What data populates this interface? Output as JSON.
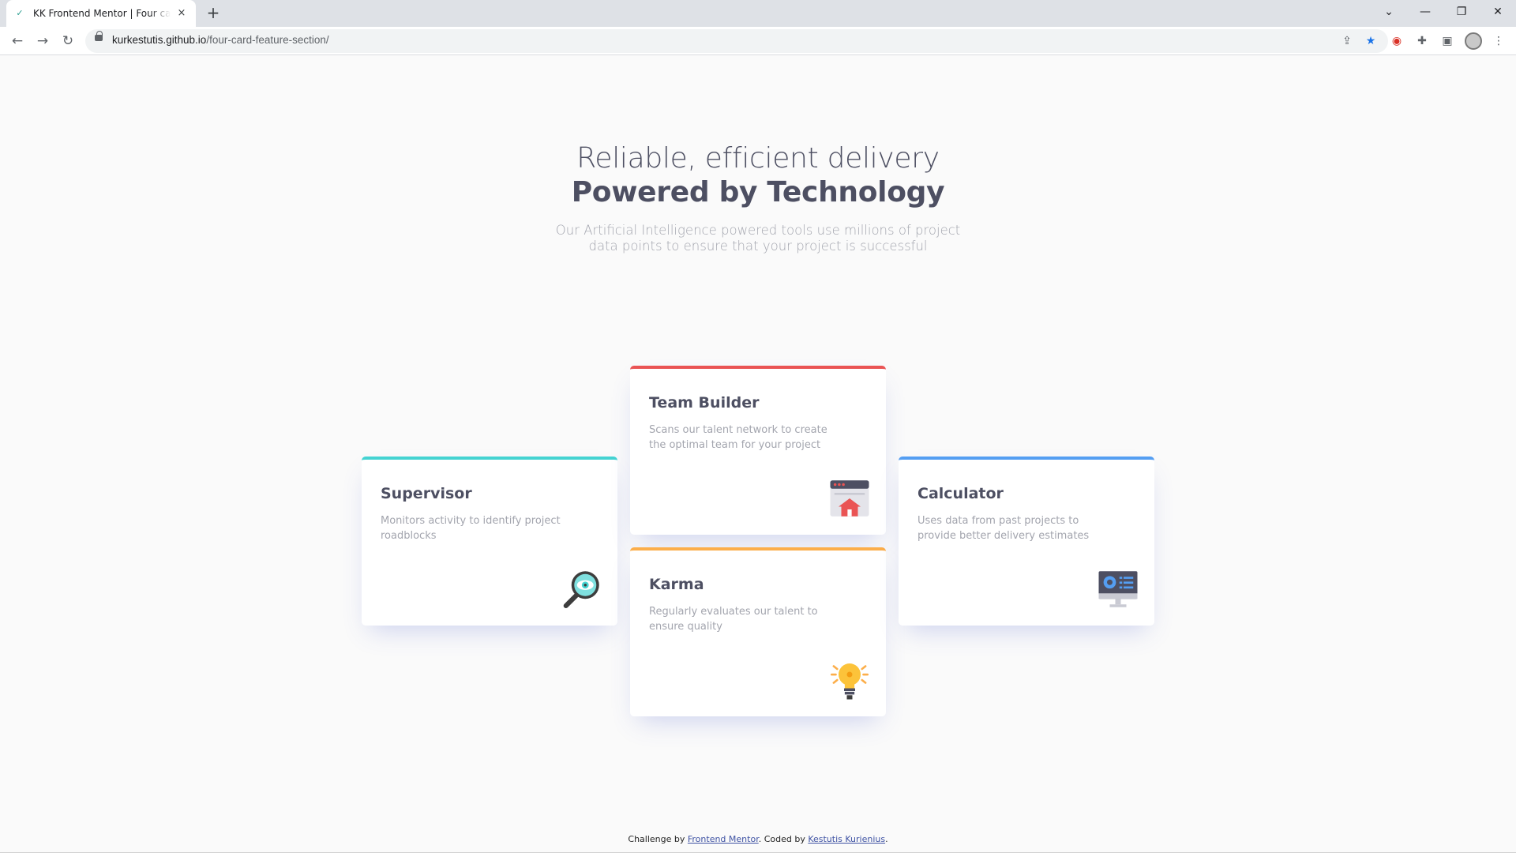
{
  "browser": {
    "tab_title": "KK Frontend Mentor | Four card feature section",
    "url_host": "kurkestutis.github.io",
    "url_path": "/four-card-feature-section/",
    "new_tab": "+",
    "tab_close": "×",
    "back": "←",
    "forward": "→",
    "reload": "↻",
    "minimize": "—",
    "maximize": "❐",
    "close": "✕",
    "tab_search": "⌄",
    "share": "⇪",
    "bookmark": "★",
    "extensions": "✚",
    "menu": "⋮",
    "accent": "#1a73e8"
  },
  "hero": {
    "line1": "Reliable, efficient delivery",
    "line2": "Powered by Technology",
    "description": "Our Artificial Intelligence powered tools use millions of project data points to ensure that your project is successful"
  },
  "cards": [
    {
      "title": "Supervisor",
      "text": "Monitors activity to identify project roadblocks",
      "icon": "magnifier-eye-icon",
      "accent": "#44d3d2"
    },
    {
      "title": "Team Builder",
      "text": "Scans our talent network to create the optimal team for your project",
      "icon": "browser-house-icon",
      "accent": "#ea5454"
    },
    {
      "title": "Karma",
      "text": "Regularly evaluates our talent to ensure quality",
      "icon": "lightbulb-icon",
      "accent": "#fcae4a"
    },
    {
      "title": "Calculator",
      "text": "Uses data from past projects to provide better delivery estimates",
      "icon": "monitor-calculator-icon",
      "accent": "#549ef2"
    }
  ],
  "footer": {
    "challenge_prefix": "Challenge by",
    "challenge_link": "Frontend Mentor",
    "coded_prefix": ". Coded by",
    "coded_link": "Kestutis Kurienius",
    "suffix": "."
  }
}
